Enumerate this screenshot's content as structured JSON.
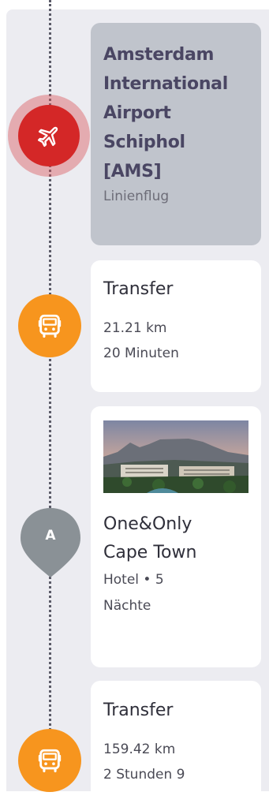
{
  "timeline": {
    "flight": {
      "title_lines": [
        "Amsterdam",
        "International",
        "Airport",
        "Schiphol",
        "[AMS]"
      ],
      "subtitle": "Linienflug",
      "icon": "airplane-icon",
      "marker_color": "#d42727"
    },
    "transfer_1": {
      "title": "Transfer",
      "distance": "21.21 km",
      "duration": "20 Minuten",
      "icon": "bus-icon",
      "marker_color": "#f7951e"
    },
    "hotel": {
      "marker_label": "A",
      "name_lines": [
        "One&Only",
        "Cape Town"
      ],
      "type_line": "Hotel • 5",
      "nights_line": "Nächte",
      "marker_color": "#8a9196"
    },
    "transfer_2": {
      "title": "Transfer",
      "distance": "159.42 km",
      "duration": "2 Stunden 9",
      "icon": "bus-icon",
      "marker_color": "#f7951e"
    }
  }
}
